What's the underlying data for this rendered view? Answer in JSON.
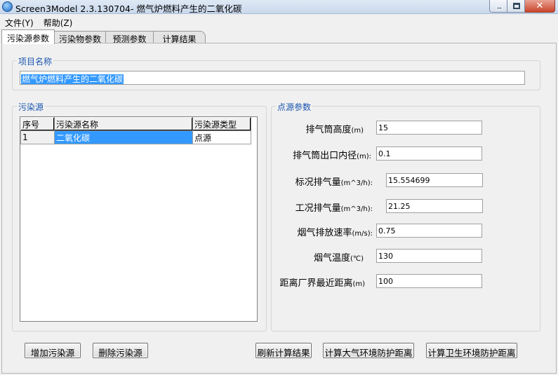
{
  "window": {
    "title": "Screen3Model 2.3.130704- 燃气炉燃料产生的二氧化碳",
    "close_glyph": "✕"
  },
  "menu": [
    "文件(Y)",
    "帮助(Z)"
  ],
  "tabs": [
    "污染源参数",
    "污染物参数",
    "预测参数",
    "计算结果"
  ],
  "project": {
    "legend": "项目名称",
    "name": "燃气炉燃料产生的二氧化碳"
  },
  "sources": {
    "legend": "污染源",
    "columns": [
      "序号",
      "污染源名称",
      "污染源类型"
    ],
    "rows": [
      {
        "index": "1",
        "name": "二氧化碳",
        "type": "点源"
      }
    ]
  },
  "params": {
    "legend": "点源参数",
    "fields": [
      {
        "label": "排气筒高度",
        "unit": "(m)",
        "value": "15"
      },
      {
        "label": "排气筒出口内径",
        "unit": "(m):",
        "value": "0.1"
      },
      {
        "label": "标况排气量",
        "unit": "(m^3/h):",
        "value": "15.554699"
      },
      {
        "label": "工况排气量",
        "unit": "(m^3/h):",
        "value": "21.25"
      },
      {
        "label": "烟气排放速率",
        "unit": "(m/s):",
        "value": "0.75"
      },
      {
        "label": "烟气温度",
        "unit": "(℃)",
        "value": "130"
      },
      {
        "label": "距离厂界最近距离",
        "unit": "(m)",
        "value": "100"
      }
    ]
  },
  "buttons": {
    "add": "增加污染源",
    "delete": "删除污染源",
    "refresh": "刷新计算结果",
    "calc_air": "计算大气环境防护距离",
    "calc_health": "计算卫生环境防护距离"
  }
}
